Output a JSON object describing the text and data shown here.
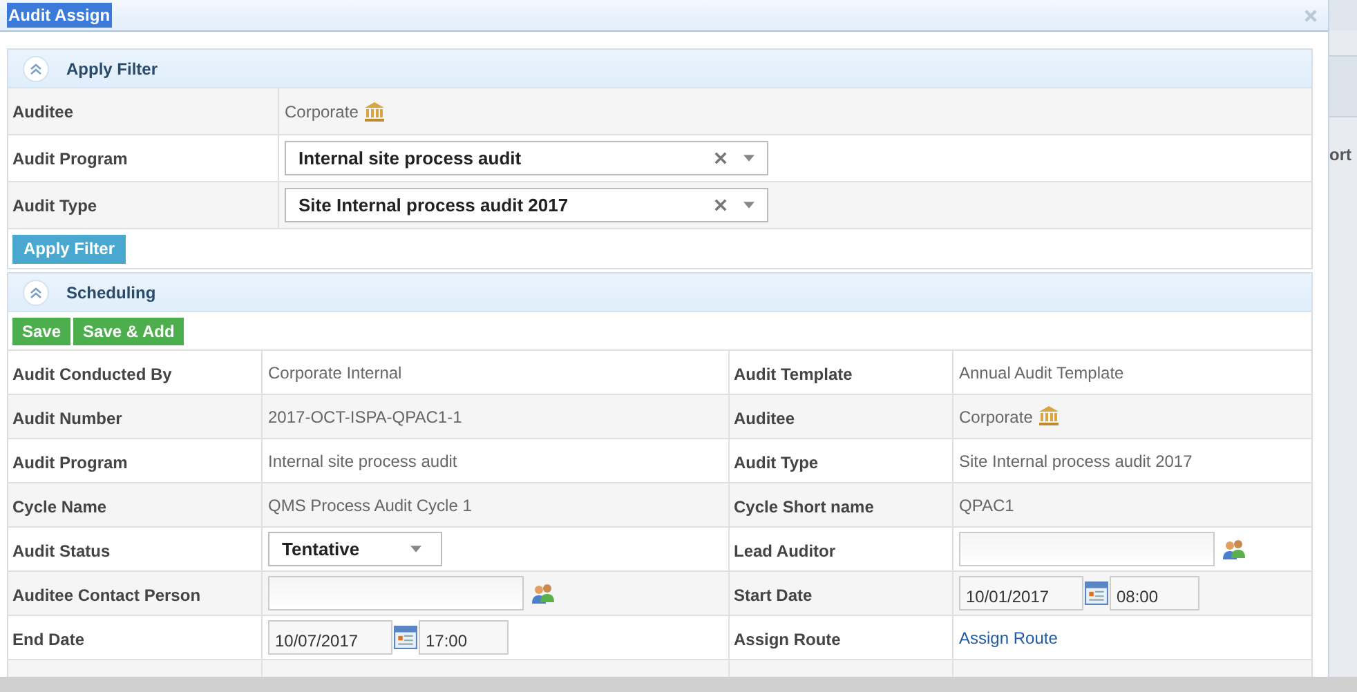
{
  "dialog": {
    "title": "Audit Assign"
  },
  "filter": {
    "title": "Apply Filter",
    "expanded": true,
    "button": "Apply Filter",
    "rows": [
      {
        "label": "Auditee",
        "kind": "org",
        "value": "Corporate"
      },
      {
        "label": "Audit Program",
        "kind": "select",
        "value": "Internal site process audit"
      },
      {
        "label": "Audit Type",
        "kind": "select",
        "value": "Site Internal process audit 2017"
      }
    ]
  },
  "scheduling": {
    "title": "Scheduling",
    "expanded": true,
    "buttons": [
      "Save",
      "Save & Add"
    ],
    "rows": [
      [
        {
          "label": "Audit Conducted By",
          "kind": "text",
          "value": "Corporate Internal"
        },
        {
          "label": "Audit Template",
          "kind": "text",
          "value": "Annual Audit Template"
        }
      ],
      [
        {
          "label": "Audit Number",
          "kind": "text",
          "value": "2017-OCT-ISPA-QPAC1-1"
        },
        {
          "label": "Auditee",
          "kind": "org",
          "value": "Corporate"
        }
      ],
      [
        {
          "label": "Audit Program",
          "kind": "text",
          "value": "Internal site process audit"
        },
        {
          "label": "Audit Type",
          "kind": "text",
          "value": "Site Internal process audit 2017"
        }
      ],
      [
        {
          "label": "Cycle Name",
          "kind": "text",
          "value": "QMS Process Audit Cycle 1"
        },
        {
          "label": "Cycle Short name",
          "kind": "text",
          "value": "QPAC1"
        }
      ],
      [
        {
          "label": "Audit Status",
          "kind": "dropdown",
          "value": "Tentative"
        },
        {
          "label": "Lead Auditor",
          "kind": "picker"
        }
      ],
      [
        {
          "label": "Auditee Contact Person",
          "kind": "picker"
        },
        {
          "label": "Start Date",
          "kind": "datetime",
          "date": "10/01/2017",
          "time": "08:00"
        }
      ],
      [
        {
          "label": "End Date",
          "kind": "datetime",
          "date": "10/07/2017",
          "time": "17:00"
        },
        {
          "label": "Assign Route",
          "kind": "link",
          "value": "Assign Route"
        }
      ]
    ]
  },
  "backdrop": {
    "text": "ort"
  }
}
